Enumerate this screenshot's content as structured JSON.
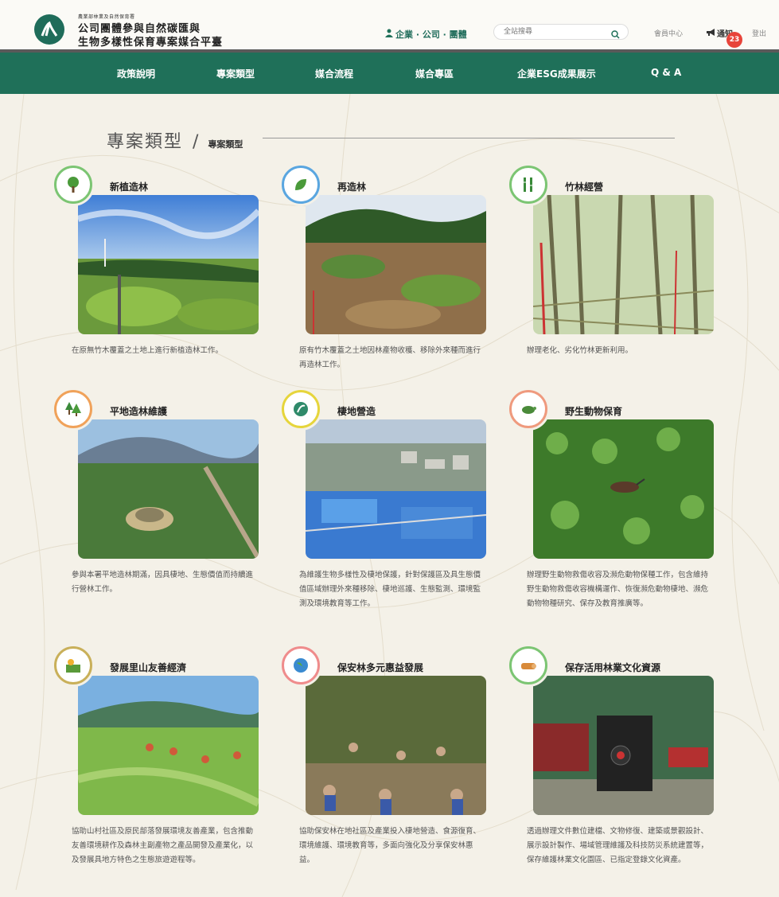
{
  "header": {
    "logo_sub": "農業部林業及自然保育署",
    "logo_line1": "公司團體參與自然碳匯與",
    "logo_line2": "生物多樣性保育專案媒合平臺",
    "audience_label": "企業 · 公司 · 團體",
    "search_placeholder": "全站搜尋",
    "member_center": "會員中心",
    "notice_label": "通知",
    "notice_count": "23",
    "logout": "登出"
  },
  "nav": {
    "items": [
      {
        "label": "政策說明"
      },
      {
        "label": "專案類型"
      },
      {
        "label": "媒合流程"
      },
      {
        "label": "媒合專區"
      },
      {
        "label": "企業ESG成果展示"
      },
      {
        "label": "Q & A"
      }
    ]
  },
  "page": {
    "title": "專案類型",
    "separator": "/",
    "breadcrumb": "專案類型"
  },
  "colors": {
    "brand_green": "#1f7059",
    "background": "#f4f1e8",
    "badge_red": "#e8443a"
  },
  "cards": [
    {
      "title": "新植造林",
      "icon": "tree-icon",
      "ring": "#7cc573",
      "desc": "在原無竹木覆蓋之土地上進行新植造林工作。"
    },
    {
      "title": "再造林",
      "icon": "leaf-icon",
      "ring": "#5aa6e0",
      "desc": "原有竹木覆蓋之土地因林產物收穫、移除外來種而進行再造林工作。"
    },
    {
      "title": "竹林經營",
      "icon": "bamboo-icon",
      "ring": "#7cc573",
      "desc": "辦理老化、劣化竹林更新利用。"
    },
    {
      "title": "平地造林維護",
      "icon": "forest-icon",
      "ring": "#f0a25a",
      "desc": "參與本署平地造林期滿，因具棲地、生態價值而持續進行營林工作。"
    },
    {
      "title": "棲地營造",
      "icon": "habitat-icon",
      "ring": "#e6d53c",
      "desc": "為維護生物多樣性及棲地保護，針對保護區及具生態價值區域辦理外來種移除、棲地巡護、生態監測、環境監測及環境教育等工作。"
    },
    {
      "title": "野生動物保育",
      "icon": "turtle-icon",
      "ring": "#ef9a7e",
      "desc": "辦理野生動物救傷收容及瀕危動物保種工作，包含維持野生動物救傷收容機構運作、恢復瀕危動物棲地、瀕危動物物種研究、保存及教育推廣等。"
    },
    {
      "title": "發展里山友善經濟",
      "icon": "satoyama-icon",
      "ring": "#c9b05a",
      "desc": "協助山村社區及原民部落發展環境友善產業，包含推動友善環境耕作及森林主副產物之產品開發及產業化，以及發展具地方特色之生態旅遊遊程等。"
    },
    {
      "title": "保安林多元惠益發展",
      "icon": "globe-icon",
      "ring": "#ef8c8c",
      "desc": "協助保安林在地社區及產業投入棲地營造、食源復育、環境維護、環境教育等，多面向強化及分享保安林惠益。"
    },
    {
      "title": "保存活用林業文化資源",
      "icon": "wood-icon",
      "ring": "#7cc573",
      "desc": "透過辦理文件數位建檔、文物修復、建築或景觀設計、展示設計製作、場域管理維護及科技防災系統建置等，保存維護林業文化園區、已指定登錄文化資產。"
    }
  ]
}
